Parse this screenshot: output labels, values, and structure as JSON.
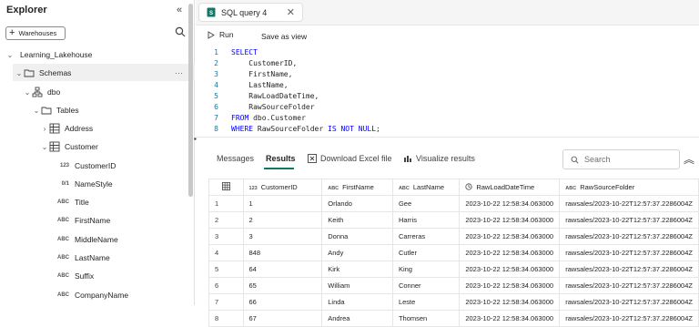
{
  "explorer": {
    "title": "Explorer",
    "collapse_glyph": "«",
    "warehouses_button": "Warehouses",
    "tree": {
      "lakehouse": "Learning_Lakehouse",
      "schemas": "Schemas",
      "dbo": "dbo",
      "tables": "Tables",
      "address": "Address",
      "customer": "Customer",
      "columns": [
        {
          "type_icon": "123",
          "name": "CustomerID"
        },
        {
          "type_icon": "0/1",
          "name": "NameStyle"
        },
        {
          "type_icon": "ABC",
          "name": "Title"
        },
        {
          "type_icon": "ABC",
          "name": "FirstName"
        },
        {
          "type_icon": "ABC",
          "name": "MiddleName"
        },
        {
          "type_icon": "ABC",
          "name": "LastName"
        },
        {
          "type_icon": "ABC",
          "name": "Suffix"
        },
        {
          "type_icon": "ABC",
          "name": "CompanyName"
        }
      ]
    }
  },
  "tab": {
    "label": "SQL query 4"
  },
  "toolbar": {
    "run": "Run",
    "save_as_view": "Save as view"
  },
  "editor": {
    "lines": [
      {
        "num": "1",
        "text": "SELECT"
      },
      {
        "num": "2",
        "text": "    CustomerID,"
      },
      {
        "num": "3",
        "text": "    FirstName,"
      },
      {
        "num": "4",
        "text": "    LastName,"
      },
      {
        "num": "5",
        "text": "    RawLoadDateTime,"
      },
      {
        "num": "6",
        "text": "    RawSourceFolder"
      },
      {
        "num": "7",
        "text": "FROM dbo.Customer"
      },
      {
        "num": "8",
        "text": "WHERE RawSourceFolder IS NOT NULL;"
      }
    ]
  },
  "results_tabs": {
    "messages": "Messages",
    "results": "Results",
    "download": "Download Excel file",
    "visualize": "Visualize results",
    "search_placeholder": "Search"
  },
  "table": {
    "headers": [
      {
        "icon": "123",
        "label": "CustomerID"
      },
      {
        "icon": "ABC",
        "label": "FirstName"
      },
      {
        "icon": "ABC",
        "label": "LastName"
      },
      {
        "icon": "clock",
        "label": "RawLoadDateTime"
      },
      {
        "icon": "ABC",
        "label": "RawSourceFolder"
      }
    ],
    "rows": [
      [
        "1",
        "1",
        "Orlando",
        "Gee",
        "2023-10-22 12:58:34.063000",
        "rawsales/2023-10-22T12:57:37.2286004Z"
      ],
      [
        "2",
        "2",
        "Keith",
        "Harris",
        "2023-10-22 12:58:34.063000",
        "rawsales/2023-10-22T12:57:37.2286004Z"
      ],
      [
        "3",
        "3",
        "Donna",
        "Carreras",
        "2023-10-22 12:58:34.063000",
        "rawsales/2023-10-22T12:57:37.2286004Z"
      ],
      [
        "4",
        "848",
        "Andy",
        "Cutler",
        "2023-10-22 12:58:34.063000",
        "rawsales/2023-10-22T12:57:37.2286004Z"
      ],
      [
        "5",
        "64",
        "Kirk",
        "King",
        "2023-10-22 12:58:34.063000",
        "rawsales/2023-10-22T12:57:37.2286004Z"
      ],
      [
        "6",
        "65",
        "William",
        "Conner",
        "2023-10-22 12:58:34.063000",
        "rawsales/2023-10-22T12:57:37.2286004Z"
      ],
      [
        "7",
        "66",
        "Linda",
        "Leste",
        "2023-10-22 12:58:34.063000",
        "rawsales/2023-10-22T12:57:37.2286004Z"
      ],
      [
        "8",
        "67",
        "Andrea",
        "Thomsen",
        "2023-10-22 12:58:34.063000",
        "rawsales/2023-10-22T12:57:37.2286004Z"
      ]
    ]
  },
  "colors": {
    "accent": "#117865",
    "keyword": "#0000ff",
    "line_number": "#237893"
  }
}
